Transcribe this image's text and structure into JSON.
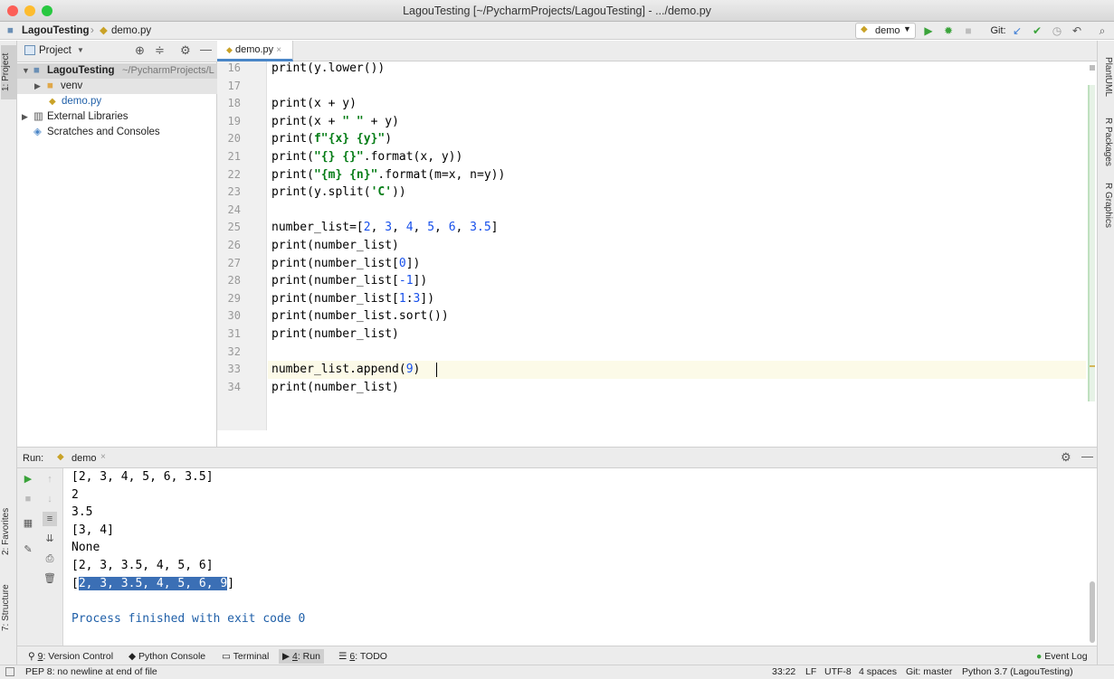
{
  "window": {
    "title": "LagouTesting [~/PycharmProjects/LagouTesting] - .../demo.py"
  },
  "navbar": {
    "project": "LagouTesting",
    "file": "demo.py",
    "run_config": "demo",
    "git_label": "Git:"
  },
  "left_strip": {
    "project_tab": "1: Project",
    "favorites_tab": "2: Favorites",
    "structure_tab": "7: Structure"
  },
  "right_strip": {
    "plantuml": "PlantUML",
    "r_packages": "R Packages",
    "r_graphics": "R Graphics"
  },
  "project_panel": {
    "title": "Project",
    "tree": [
      {
        "label": "LagouTesting",
        "hint": "~/PycharmProjects/L",
        "icon": "folder-icon"
      },
      {
        "label": "venv",
        "icon": "folder-icon"
      },
      {
        "label": "demo.py",
        "icon": "python-file-icon"
      },
      {
        "label": "External Libraries",
        "icon": "library-icon"
      },
      {
        "label": "Scratches and Consoles",
        "icon": "scratches-icon"
      }
    ]
  },
  "editor": {
    "tab_label": "demo.py",
    "line_numbers": [
      "16",
      "17",
      "18",
      "19",
      "20",
      "21",
      "22",
      "23",
      "24",
      "25",
      "26",
      "27",
      "28",
      "29",
      "30",
      "31",
      "32",
      "33",
      "34"
    ],
    "lines": [
      "print(y.lower())",
      "",
      "print(x + y)",
      "print(x + \" \" + y)",
      "print(f\"{x} {y}\")",
      "print(\"{} {}\".format(x, y))",
      "print(\"{m} {n}\".format(m=x, n=y))",
      "print(y.split('C'))",
      "",
      "number_list=[2, 3, 4, 5, 6, 3.5]",
      "print(number_list)",
      "print(number_list[0])",
      "print(number_list[-1])",
      "print(number_list[1:3])",
      "print(number_list.sort())",
      "print(number_list)",
      "",
      "number_list.append(9)",
      "print(number_list)"
    ]
  },
  "run_panel": {
    "label": "Run:",
    "tab": "demo",
    "output": [
      "[2, 3, 4, 5, 6, 3.5]",
      "2",
      "3.5",
      "[3, 4]",
      "None",
      "[2, 3, 3.5, 4, 5, 6]"
    ],
    "last_prefix": "[",
    "last_selected": "2, 3, 3.5, 4, 5, 6, 9",
    "last_suffix": "]",
    "finish": "Process finished with exit code 0"
  },
  "bottom_tabs": [
    {
      "num": "9",
      "label": ": Version Control"
    },
    {
      "num": "",
      "label": "Python Console"
    },
    {
      "num": "",
      "label": "Terminal"
    },
    {
      "num": "4",
      "label": ": Run"
    },
    {
      "num": "6",
      "label": ": TODO"
    }
  ],
  "event_log": "Event Log",
  "status": {
    "message": "PEP 8: no newline at end of file",
    "position": "33:22",
    "line_sep": "LF",
    "encoding": "UTF-8",
    "indent": "4 spaces",
    "git": "Git: master",
    "interpreter": "Python 3.7 (LagouTesting)"
  },
  "colors": {
    "accent": "#4a86c7",
    "selection": "#3b6fb5",
    "run_green": "#3aa33a"
  }
}
